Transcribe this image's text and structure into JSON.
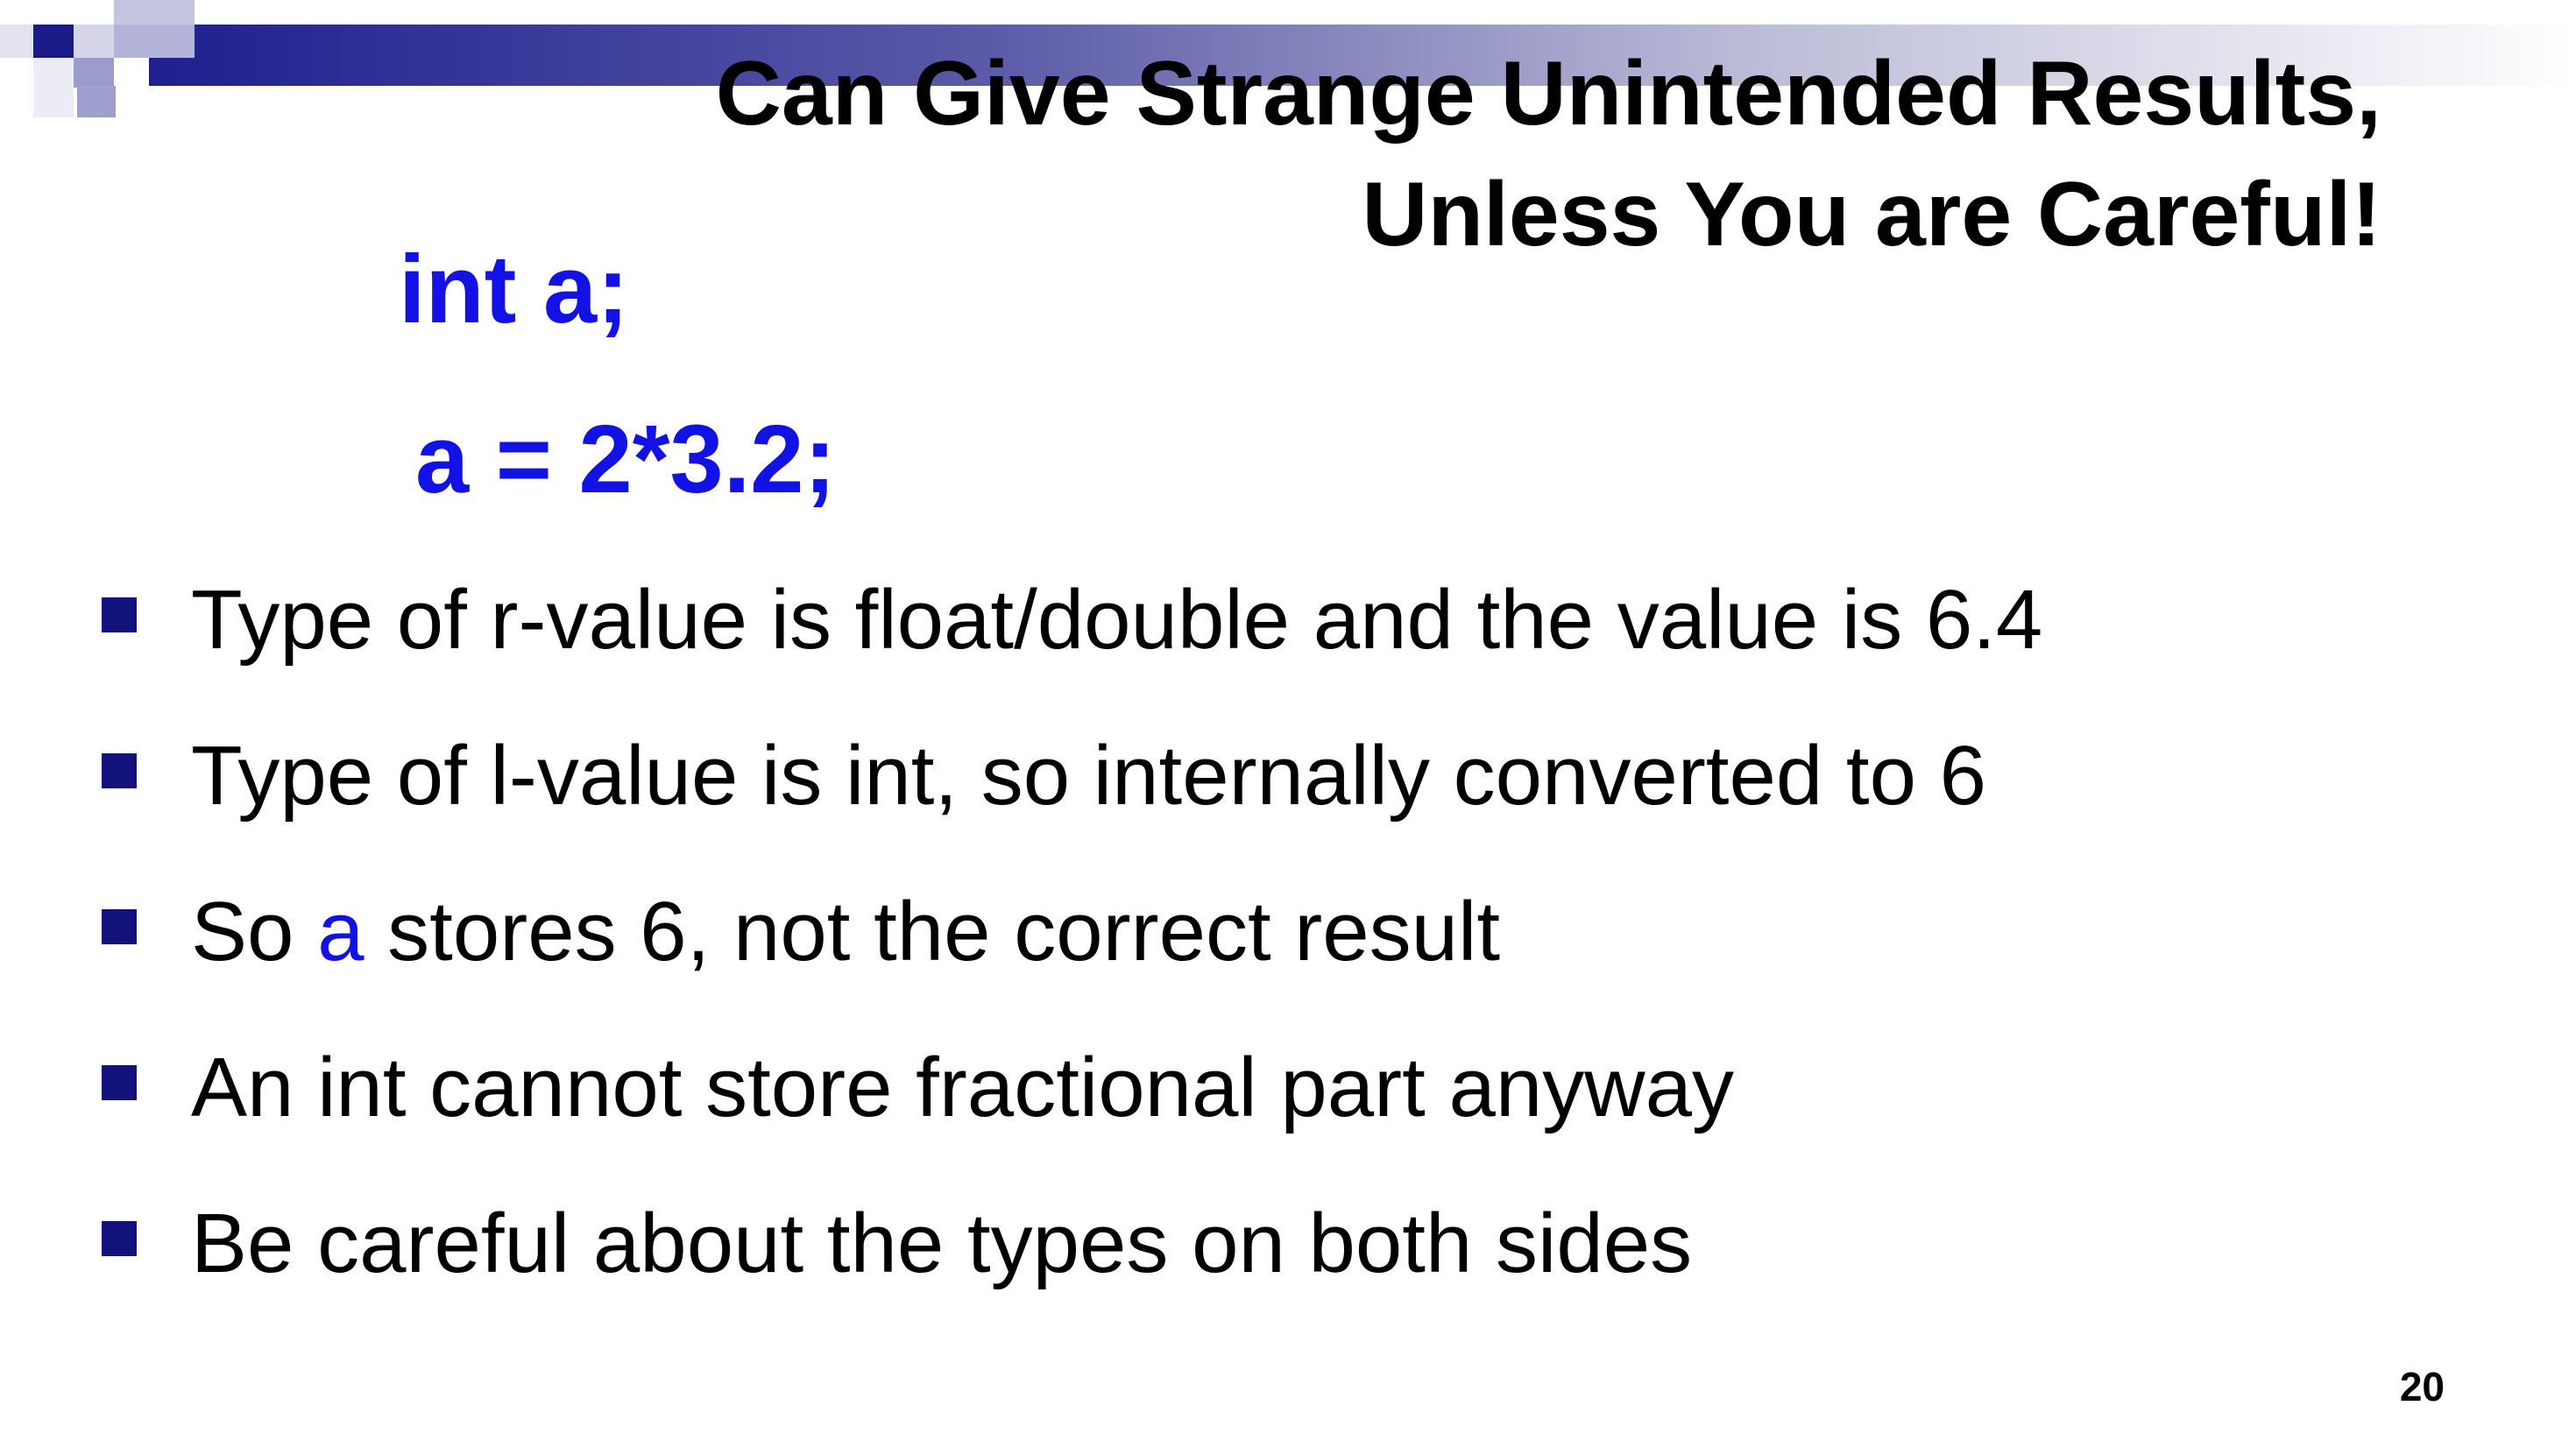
{
  "slide": {
    "title_line_1": "Can Give Strange Unintended Results,",
    "title_line_2": "Unless You are Careful!",
    "code_line_1": "int a;",
    "code_line_2": "a = 2*3.2;",
    "bullets": [
      {
        "text": "Type of r-value is float/double and the value is 6.4"
      },
      {
        "text": "Type of l-value is int, so internally converted to 6"
      },
      {
        "text_before": "So ",
        "text_highlight": "a",
        "text_after": " stores 6, not the correct result"
      },
      {
        "text": "An int cannot store fractional part anyway"
      },
      {
        "text": "Be careful about the types on both sides"
      }
    ],
    "page_number": "20"
  },
  "colors": {
    "code": "#1212e6",
    "bullet": "#12127a",
    "text": "#000000",
    "header_bar": "#1f1f8f"
  }
}
